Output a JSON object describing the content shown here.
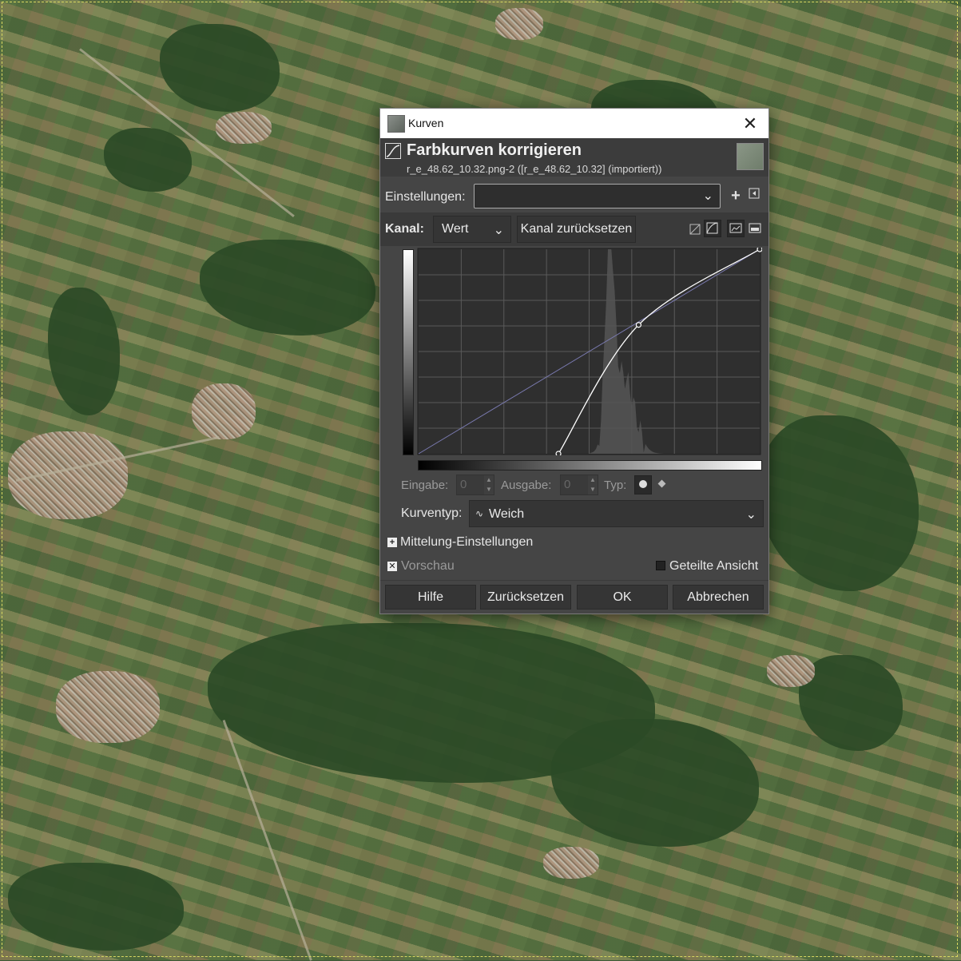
{
  "window": {
    "title": "Kurven"
  },
  "header": {
    "title": "Farbkurven korrigieren",
    "subtitle": "r_e_48.62_10.32.png-2 ([r_e_48.62_10.32] (importiert))"
  },
  "settings": {
    "label": "Einstellungen:",
    "value": ""
  },
  "channel": {
    "label": "Kanal:",
    "value": "Wert",
    "reset_label": "Kanal zurücksetzen"
  },
  "point_editor": {
    "input_label": "Eingabe:",
    "input_value": "0",
    "output_label": "Ausgabe:",
    "output_value": "0",
    "type_label": "Typ:"
  },
  "curve_type": {
    "label": "Kurventyp:",
    "value": "Weich"
  },
  "options": {
    "averaging_label": "Mittelung-Einstellungen",
    "preview_label": "Vorschau",
    "preview_checked": true,
    "split_view_label": "Geteilte Ansicht",
    "split_view_checked": false
  },
  "buttons": {
    "help": "Hilfe",
    "reset": "Zurücksetzen",
    "ok": "OK",
    "cancel": "Abbrechen"
  },
  "curve": {
    "control_points": [
      [
        0.41,
        0.0
      ],
      [
        0.645,
        0.63
      ],
      [
        1.0,
        1.0
      ]
    ]
  },
  "icons": {
    "close": "close-icon",
    "add_preset": "plus-icon",
    "preset_menu": "menu-arrow-icon",
    "linear_histogram": "linear-histogram-icon",
    "log_histogram": "log-histogram-icon"
  },
  "colors": {
    "dialog_bg": "#454545",
    "accent_curve": "#ffffff",
    "identity_line": "#7a7ab0"
  }
}
